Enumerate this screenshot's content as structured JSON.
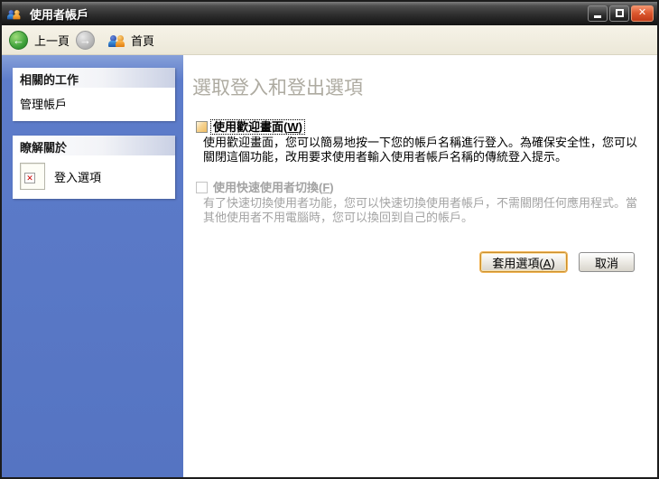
{
  "window": {
    "title": "使用者帳戶",
    "controls": {
      "minimize": "",
      "maximize": "",
      "close": "✕"
    }
  },
  "toolbar": {
    "back_icon": "←",
    "back_label": "上一頁",
    "forward_icon": "→",
    "home_label": "首頁"
  },
  "sidebar": {
    "boxes": [
      {
        "header": "相關的工作",
        "items": [
          {
            "label": "管理帳戶"
          }
        ]
      },
      {
        "header": "瞭解關於",
        "items": [
          {
            "label": "登入選項",
            "icon": "broken-image-icon",
            "icon_glyph": "✕"
          }
        ]
      }
    ]
  },
  "main": {
    "heading": "選取登入和登出選項",
    "options": [
      {
        "label_pre": "使用歡迎畫面(",
        "label_key": "W",
        "label_post": ")",
        "checked": false,
        "disabled": false,
        "description": "使用歡迎畫面，您可以簡易地按一下您的帳戶名稱進行登入。為確保安全性，您可以關閉這個功能，改用要求使用者輸入使用者帳戶名稱的傳統登入提示。"
      },
      {
        "label_pre": "使用快速使用者切換(",
        "label_key": "F",
        "label_post": ")",
        "checked": false,
        "disabled": true,
        "description": "有了快速切換使用者功能，您可以快速切換使用者帳戶，不需關閉任何應用程式。當其他使用者不用電腦時，您可以換回到自己的帳戶。"
      }
    ],
    "buttons": {
      "apply_pre": "套用選項(",
      "apply_key": "A",
      "apply_post": ")",
      "cancel": "取消"
    }
  },
  "colors": {
    "titlebar_dark": "#2e2e2e",
    "close_red": "#dd5a31",
    "toolbar_beige": "#f0ecdd",
    "sidebar_blue": "#5574c2",
    "heading_gray": "#aeaba1",
    "default_button_orange": "#f2b558"
  }
}
